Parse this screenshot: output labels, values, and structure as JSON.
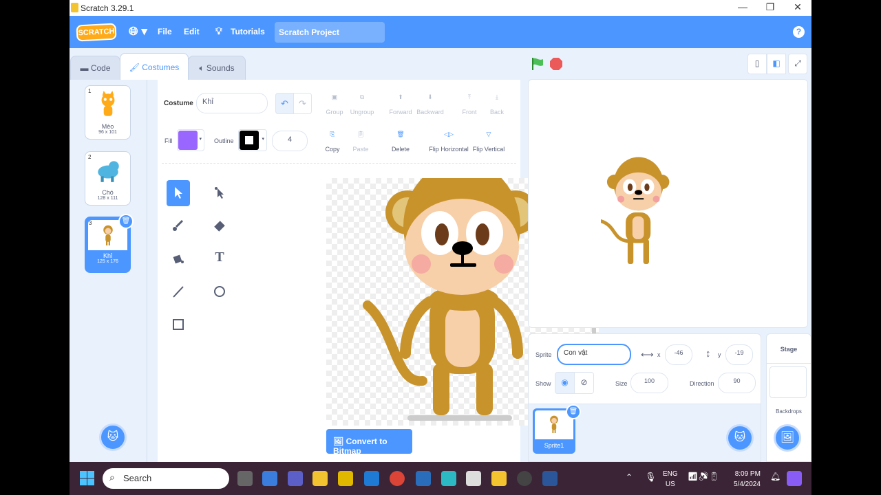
{
  "window": {
    "title": "Scratch 3.29.1",
    "controls": {
      "minimize": "—",
      "maximize": "❐",
      "close": "✕"
    }
  },
  "menu": {
    "logo": "SCRATCH",
    "file": "File",
    "edit": "Edit",
    "tutorials": "Tutorials",
    "project_title": "Scratch Project",
    "help": "?"
  },
  "tabs": {
    "code": "Code",
    "costumes": "Costumes",
    "sounds": "Sounds"
  },
  "costumes": [
    {
      "num": "1",
      "name": "Mèo",
      "size": "96 x 101"
    },
    {
      "num": "2",
      "name": "Chó",
      "size": "128 x 111"
    },
    {
      "num": "3",
      "name": "Khỉ",
      "size": "125 x 176"
    }
  ],
  "editor": {
    "costume_label": "Costume",
    "costume_name": "Khỉ",
    "fill_label": "Fill",
    "outline_label": "Outline",
    "outline_width": "4",
    "buttons": {
      "group": "Group",
      "ungroup": "Ungroup",
      "forward": "Forward",
      "backward": "Backward",
      "front": "Front",
      "back": "Back",
      "copy": "Copy",
      "paste": "Paste",
      "delete": "Delete",
      "flip_h": "Flip Horizontal",
      "flip_v": "Flip Vertical"
    },
    "convert": "Convert to Bitmap",
    "zoom": {
      "out": "−",
      "reset": "=",
      "in": "+"
    },
    "fill_color": "#9966ff",
    "outline_color": "#000000"
  },
  "sprite_info": {
    "sprite_label": "Sprite",
    "sprite_name": "Con vật",
    "x_label": "x",
    "x": "-46",
    "y_label": "y",
    "y": "-19",
    "show_label": "Show",
    "size_label": "Size",
    "size": "100",
    "direction_label": "Direction",
    "direction": "90"
  },
  "sprites": [
    {
      "name": "Sprite1"
    }
  ],
  "stage_panel": {
    "title": "Stage",
    "backdrops": "Backdrops"
  },
  "taskbar": {
    "search": "Search",
    "lang": "ENG",
    "region": "US",
    "time": "8:09 PM",
    "date": "5/4/2024"
  }
}
